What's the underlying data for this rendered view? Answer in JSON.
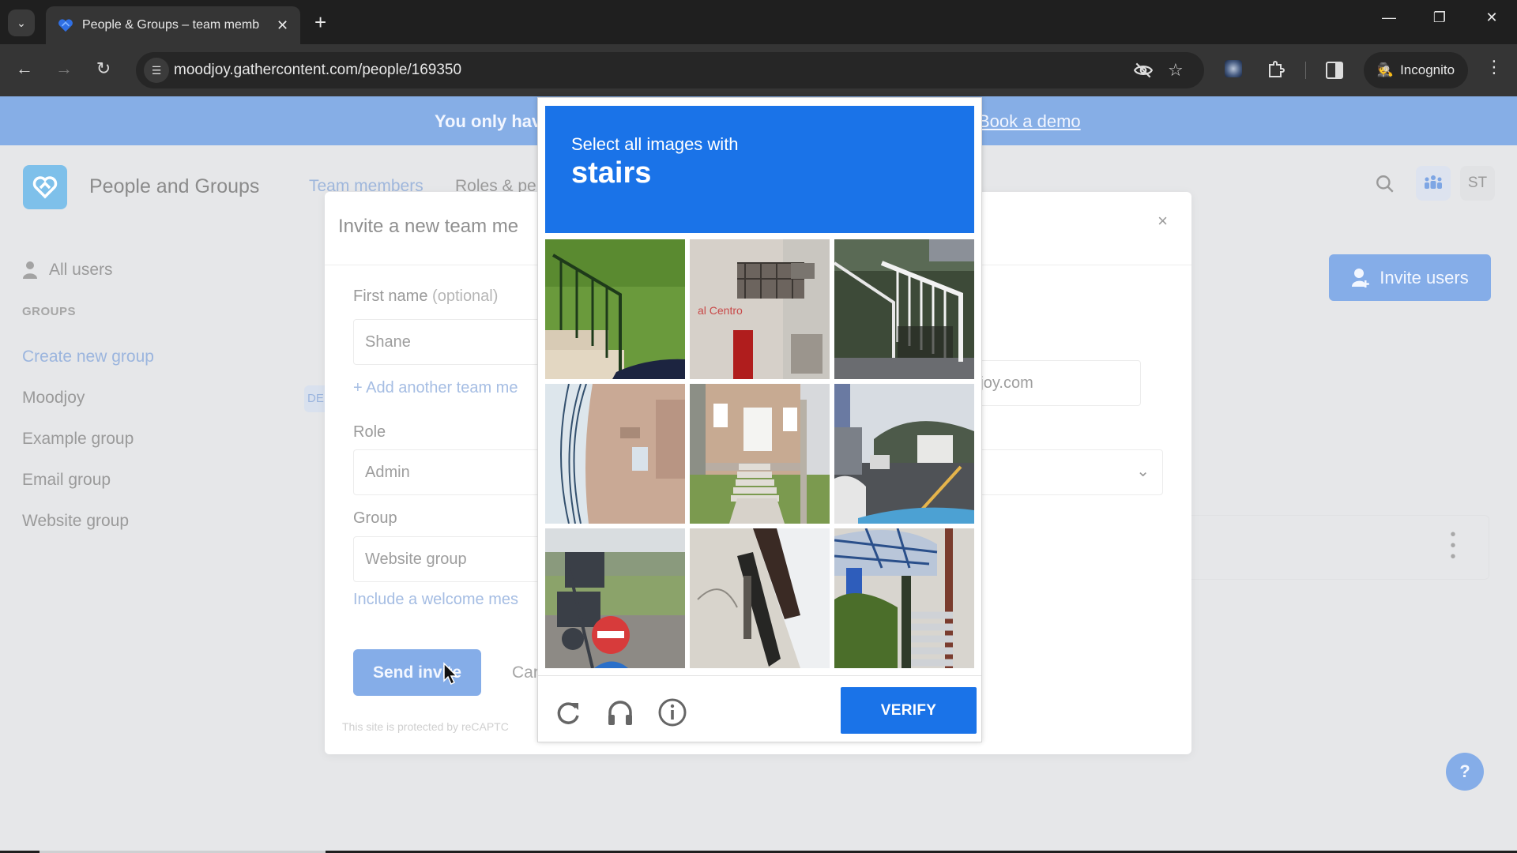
{
  "browser": {
    "tab_title": "People & Groups – team memb",
    "url": "moodjoy.gathercontent.com/people/169350",
    "incognito_label": "Incognito",
    "icons": [
      "tab-search-icon",
      "favicon-heart-icon",
      "close-icon",
      "new-tab-icon",
      "minimize-icon",
      "restore-icon",
      "window-close-icon",
      "back-icon",
      "forward-icon",
      "reload-icon",
      "site-info-icon",
      "eye-off-icon",
      "bookmark-star-icon",
      "extension-avatar-icon",
      "puzzle-extensions-icon",
      "side-panel-icon",
      "incognito-icon",
      "more-menu-icon"
    ]
  },
  "banner": {
    "text": "You only hav",
    "link": "Book a demo"
  },
  "header": {
    "app_title": "People and Groups",
    "tabs": [
      {
        "label": "Team members",
        "active": true
      },
      {
        "label": "Roles & pe",
        "active": false
      }
    ],
    "avatar_initials": "ST"
  },
  "sidebar": {
    "all_users": "All users",
    "groups_heading": "GROUPS",
    "create_group": "Create new group",
    "groups": [
      "Moodjoy",
      "Example group",
      "Email group",
      "Website group"
    ],
    "badge": "DE"
  },
  "main": {
    "invite_users_label": "Invite users",
    "help_label": "?"
  },
  "dialog": {
    "title": "Invite a new team me",
    "close": "×",
    "first_name_label": "First name",
    "first_name_optional": "(optional)",
    "first_name_value": "Shane",
    "email_suffix": "@moodjoy.com",
    "add_another": "+ Add another team me",
    "role_label": "Role",
    "role_value": "Admin",
    "group_label": "Group",
    "group_value": "Website group",
    "welcome_link": "Include a welcome mes",
    "send_label": "Send invite",
    "cancel_label": "Car",
    "recaptcha_note": "This site is protected by reCAPTC"
  },
  "captcha": {
    "instruction": "Select all images with",
    "target": "stairs",
    "tiles": [
      {
        "desc": "green railing and steps by lawn"
      },
      {
        "desc": "building facade with balcony"
      },
      {
        "desc": "white wooden staircase"
      },
      {
        "desc": "building with overhead wires"
      },
      {
        "desc": "house front with stairs"
      },
      {
        "desc": "street with truck"
      },
      {
        "desc": "traffic lights and no-entry sign"
      },
      {
        "desc": "building wall and window"
      },
      {
        "desc": "outdoor metal stairs"
      }
    ],
    "verify_label": "VERIFY",
    "icons": [
      "reload-icon",
      "headphones-icon",
      "info-icon"
    ],
    "accent_color": "#1a73e8"
  }
}
